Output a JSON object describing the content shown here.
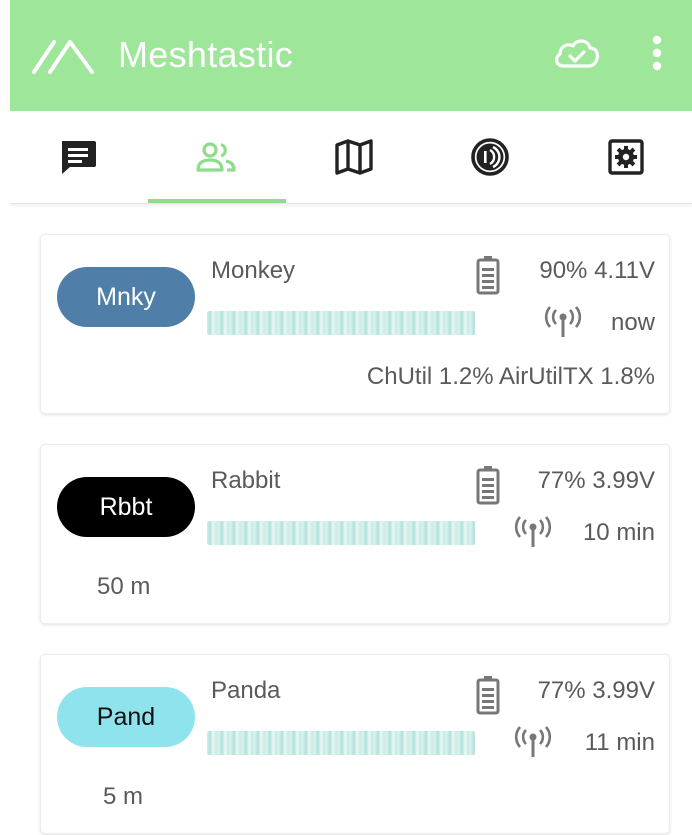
{
  "app": {
    "title": "Meshtastic",
    "bar_color": "#9ee79a",
    "accent": "#8fdc8a"
  },
  "icons": {
    "logo": "meshtastic-logo-icon",
    "connection": "cloud-check-icon",
    "menu": "more-vert-icon"
  },
  "tabs": [
    {
      "id": "messages",
      "icon": "chat-icon",
      "selected": false
    },
    {
      "id": "nodes",
      "icon": "people-icon",
      "selected": true
    },
    {
      "id": "map",
      "icon": "map-icon",
      "selected": false
    },
    {
      "id": "channel",
      "icon": "signal-channel-icon",
      "selected": false
    },
    {
      "id": "settings",
      "icon": "settings-gear-icon",
      "selected": false
    }
  ],
  "nodes": [
    {
      "short_name": "Mnky",
      "long_name": "Monkey",
      "chip_color": "#4f7ea8",
      "chip_text_color": "#ffffff",
      "battery": "90% 4.11V",
      "last_heard": "now",
      "utilization": "ChUtil 1.2% AirUtilTX 1.8%",
      "distance": ""
    },
    {
      "short_name": "Rbbt",
      "long_name": "Rabbit",
      "chip_color": "#000000",
      "chip_text_color": "#ffffff",
      "battery": "77% 3.99V",
      "last_heard": "10 min",
      "utilization": "",
      "distance": "50 m"
    },
    {
      "short_name": "Pand",
      "long_name": "Panda",
      "chip_color": "#8ee3ec",
      "chip_text_color": "#111111",
      "battery": "77% 3.99V",
      "last_heard": "11 min",
      "utilization": "",
      "distance": "5 m"
    }
  ]
}
